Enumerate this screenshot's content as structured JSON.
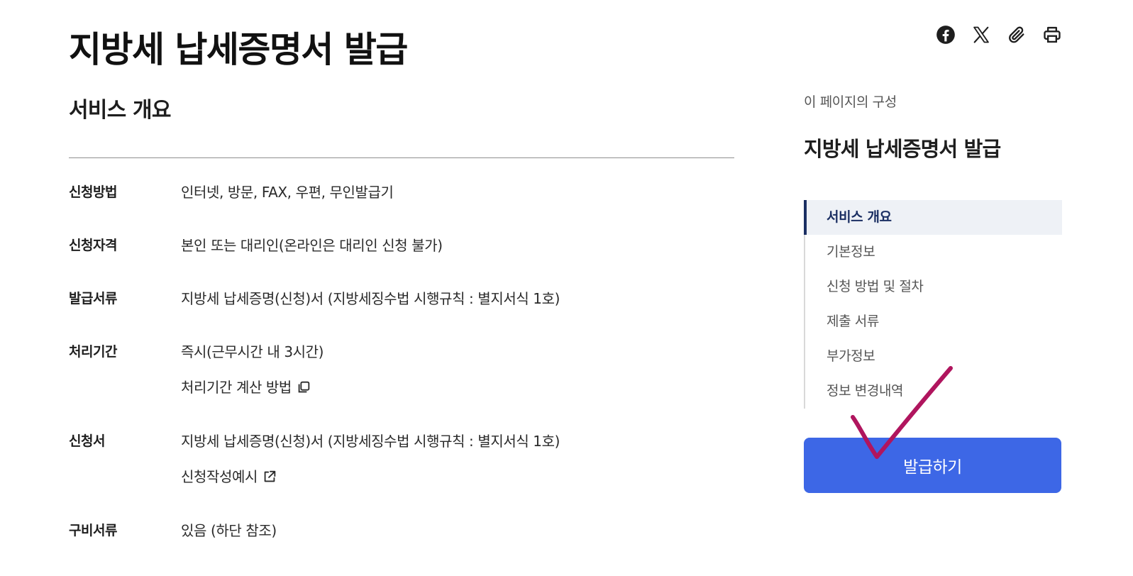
{
  "page": {
    "title": "지방세 납세증명서 발급"
  },
  "share": {
    "items": [
      {
        "icon": "facebook-icon"
      },
      {
        "icon": "x-icon"
      },
      {
        "icon": "paperclip-icon"
      },
      {
        "icon": "printer-icon"
      }
    ]
  },
  "overview": {
    "title": "서비스 개요",
    "rows": [
      {
        "label": "신청방법",
        "value": "인터넷, 방문, FAX, 우편, 무인발급기"
      },
      {
        "label": "신청자격",
        "value": "본인 또는 대리인(온라인은 대리인 신청 불가)"
      },
      {
        "label": "발급서류",
        "value": "지방세 납세증명(신청)서 (지방세징수법 시행규칙 : 별지서식 1호)"
      },
      {
        "label": "처리기간",
        "value": "즉시(근무시간 내 3시간)",
        "link": "처리기간 계산 방법",
        "link_icon": "copy-window-icon"
      },
      {
        "label": "신청서",
        "value": "지방세 납세증명(신청)서 (지방세징수법 시행규칙 : 별지서식 1호)",
        "link": "신청작성예시",
        "link_icon": "external-link-icon"
      },
      {
        "label": "구비서류",
        "value": "있음 (하단 참조)"
      }
    ]
  },
  "toc": {
    "caption": "이 페이지의 구성",
    "title": "지방세 납세증명서 발급",
    "items": [
      "서비스 개요",
      "기본정보",
      "신청 방법 및 절차",
      "제출 서류",
      "부가정보",
      "정보 변경내역"
    ],
    "active_index": 0
  },
  "action": {
    "issue_label": "발급하기"
  },
  "colors": {
    "accent": "#3d67e6",
    "toc_active": "#1b2f63",
    "annotation_check": "#b0155e"
  }
}
